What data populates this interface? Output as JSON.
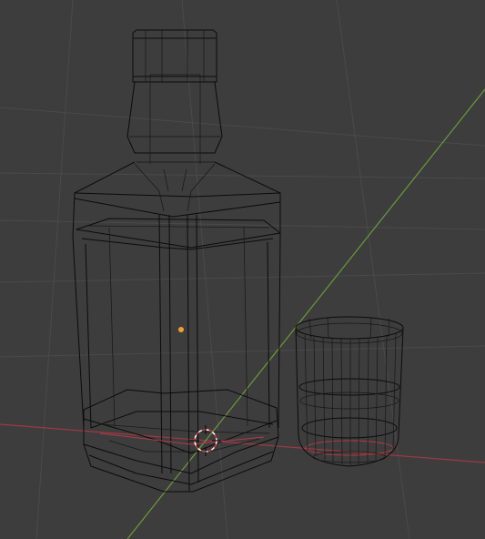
{
  "viewport": {
    "background": "#3d3d3d",
    "grid_color": "#4a4a4a",
    "axis_x_color": "#9a3a45",
    "axis_y_color": "#6e9a3a",
    "wire_color": "#0b0b0b",
    "origin_color": "#f0a030"
  },
  "objects": [
    {
      "name": "bottle",
      "display": "wireframe"
    },
    {
      "name": "glass",
      "display": "wireframe"
    }
  ],
  "icons": {
    "cursor": "3d-cursor-icon",
    "origin": "object-origin-icon"
  }
}
